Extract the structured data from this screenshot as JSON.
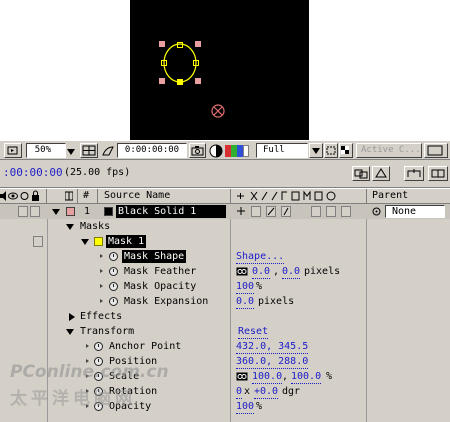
{
  "viewer": {
    "zoom": "50%",
    "timecode": "0:00:00:00",
    "resolution": "Full",
    "active_camera": "Active C..."
  },
  "timeline": {
    "timecode": ":00:00:00",
    "fps": "(25.00 fps)",
    "col_num": "#",
    "col_source": "Source Name",
    "col_parent": "Parent"
  },
  "layer": {
    "number": "1",
    "name": "Black Solid 1",
    "label_color": "#e6a0a0",
    "parent": "None"
  },
  "props": {
    "masks": "Masks",
    "mask1": "Mask 1",
    "mask1_color": "#ffff00",
    "mask_shape": "Mask Shape",
    "mask_shape_val": "Shape...",
    "mask_feather": "Mask Feather",
    "mask_feather_x": "0.0",
    "mask_feather_sep": ",",
    "mask_feather_y": "0.0",
    "mask_feather_unit": "pixels",
    "mask_opacity": "Mask Opacity",
    "mask_opacity_val": "100",
    "mask_opacity_unit": "%",
    "mask_expansion": "Mask Expansion",
    "mask_expansion_val": "0.0",
    "mask_expansion_unit": "pixels",
    "effects": "Effects",
    "transform": "Transform",
    "reset": "Reset",
    "anchor_point": "Anchor Point",
    "anchor_val": "432.0, 345.5",
    "position": "Position",
    "position_val": "360.0, 288.0",
    "scale": "Scale",
    "scale_x": "100.0",
    "scale_sep": ",",
    "scale_y": "100.0",
    "scale_unit": "%",
    "rotation": "Rotation",
    "rotation_turns": "0",
    "rotation_x": "x",
    "rotation_deg": "+0.0",
    "rotation_unit": "dgr",
    "opacity": "Opacity",
    "opacity_val": "100",
    "opacity_unit": "%"
  },
  "watermark": {
    "line1": "PConline.com.cn",
    "line2": "太平洋电脑网"
  },
  "icons": [
    "display-icon",
    "chevron-down-icon",
    "safe-zones-icon",
    "camera-icon",
    "channels-icon",
    "region-of-interest-icon",
    "transparency-grid-icon",
    "audio-icon",
    "eye-icon",
    "lock-icon",
    "stopwatch-icon",
    "solid-swatch-icon",
    "parent-pickwhip-icon",
    "link-icon"
  ],
  "colors": {
    "panel": "#d4d0c8",
    "value_blue": "#1c1cc8",
    "mask_path": "#ffff00",
    "handle": "#e8a0a0"
  }
}
